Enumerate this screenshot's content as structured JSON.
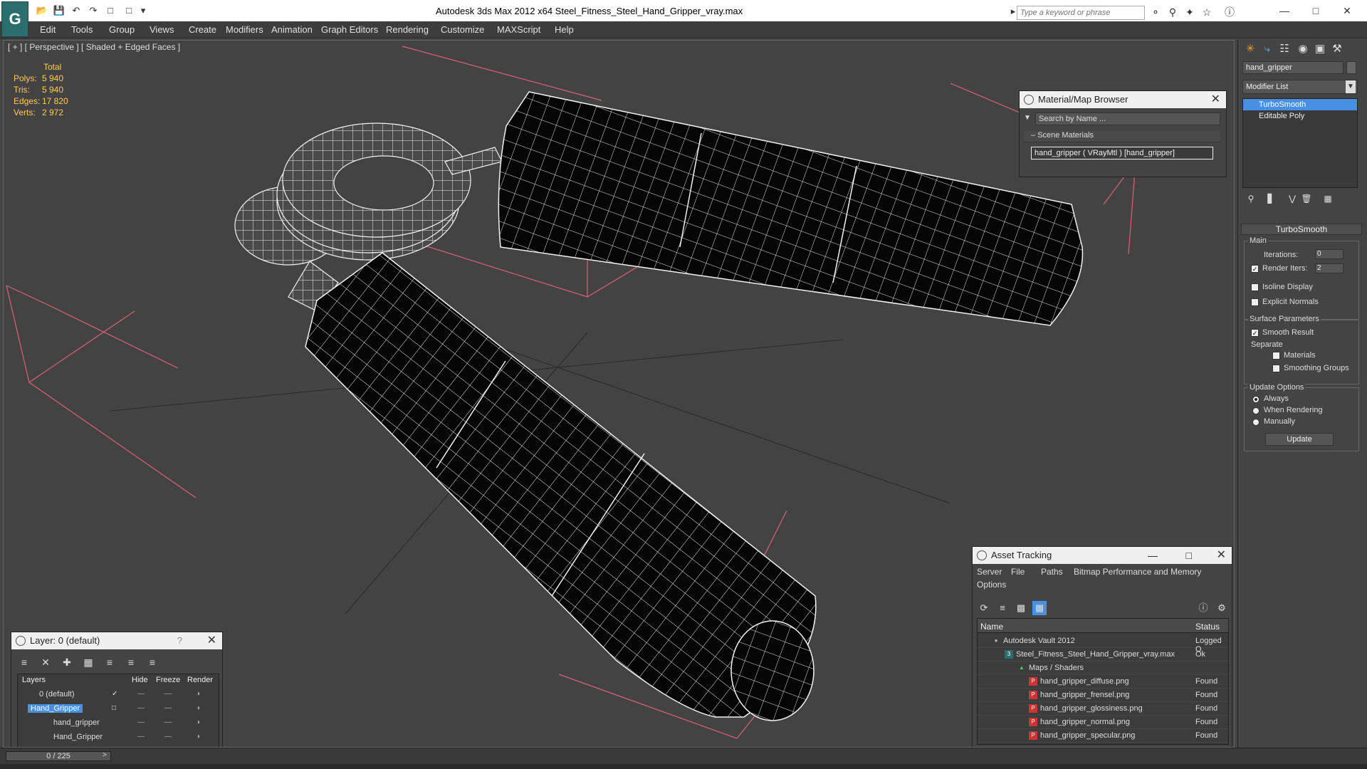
{
  "window": {
    "title": "Autodesk 3ds Max  2012 x64       Steel_Fitness_Steel_Hand_Gripper_vray.max",
    "search_placeholder": "Type a keyword or phrase",
    "logo": "G"
  },
  "menu": [
    "Edit",
    "Tools",
    "Group",
    "Views",
    "Create",
    "Modifiers",
    "Animation",
    "Graph Editors",
    "Rendering",
    "Customize",
    "MAXScript",
    "Help"
  ],
  "viewport": {
    "label": "[ + ] [ Perspective ] [ Shaded + Edged Faces ]",
    "stats": {
      "header": "Total",
      "rows": [
        {
          "label": "Polys:",
          "value": "5 940"
        },
        {
          "label": "Tris:",
          "value": "5 940"
        },
        {
          "label": "Edges:",
          "value": "17 820"
        },
        {
          "label": "Verts:",
          "value": "2 972"
        }
      ]
    }
  },
  "material_browser": {
    "title": "Material/Map Browser",
    "search_placeholder": "Search by Name ...",
    "section": "Scene Materials",
    "item": "hand_gripper  ( VRayMtl )  [hand_gripper]"
  },
  "command_panel": {
    "object_name": "hand_gripper",
    "modifier_list": "Modifier List",
    "stack": [
      "TurboSmooth",
      "Editable Poly"
    ],
    "rollout": "TurboSmooth",
    "main_group": "Main",
    "iterations_label": "Iterations:",
    "iterations_value": "0",
    "render_iters_label": "Render Iters:",
    "render_iters_value": "2",
    "isoline": "Isoline Display",
    "explicit_normals": "Explicit Normals",
    "surface_group": "Surface Parameters",
    "smooth_result": "Smooth Result",
    "separate": "Separate",
    "materials": "Materials",
    "smoothing_groups": "Smoothing Groups",
    "update_group": "Update Options",
    "always": "Always",
    "when_rendering": "When Rendering",
    "manually": "Manually",
    "update_btn": "Update"
  },
  "layer_panel": {
    "title": "Layer: 0 (default)",
    "help": "?",
    "columns": [
      "Layers",
      "Hide",
      "Freeze",
      "Render"
    ],
    "rows": [
      "0 (default)",
      "Hand_Gripper",
      "hand_gripper",
      "Hand_Gripper"
    ]
  },
  "asset_panel": {
    "title": "Asset Tracking",
    "menu": [
      "Server",
      "File",
      "Paths",
      "Bitmap Performance and Memory",
      "Options"
    ],
    "columns": [
      "Name",
      "Status"
    ],
    "rows": [
      {
        "name": "Autodesk Vault 2012",
        "status": "Logged O"
      },
      {
        "name": "Steel_Fitness_Steel_Hand_Gripper_vray.max",
        "status": "Ok"
      },
      {
        "name": "Maps / Shaders",
        "status": ""
      },
      {
        "name": "hand_gripper_diffuse.png",
        "status": "Found"
      },
      {
        "name": "hand_gripper_frensel.png",
        "status": "Found"
      },
      {
        "name": "hand_gripper_glossiness.png",
        "status": "Found"
      },
      {
        "name": "hand_gripper_normal.png",
        "status": "Found"
      },
      {
        "name": "hand_gripper_specular.png",
        "status": "Found"
      }
    ]
  },
  "timeline": {
    "frame": "0 / 225"
  },
  "colors": {
    "selection": "#4a90e2",
    "stats": "#ffcc55",
    "gizmo": "#d9607a"
  }
}
